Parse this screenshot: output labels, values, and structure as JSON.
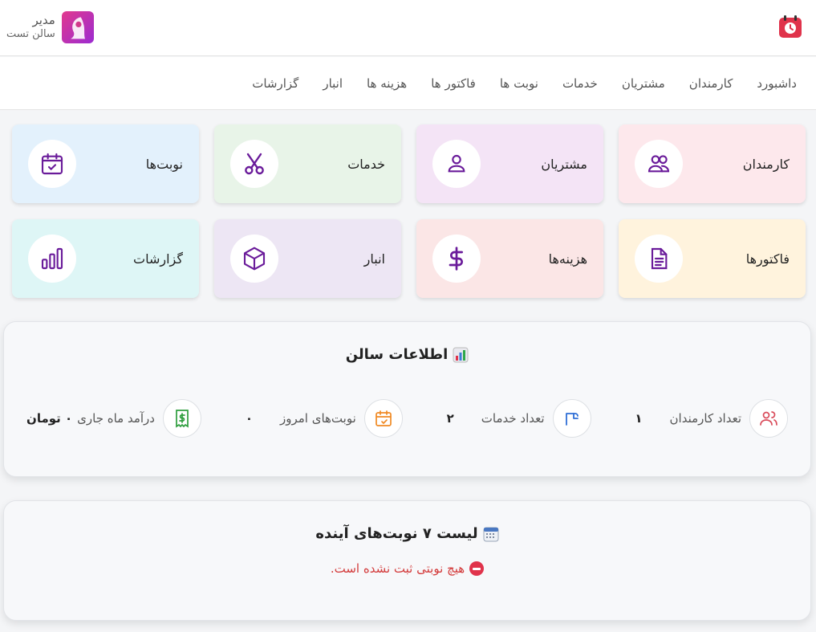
{
  "header": {
    "user_role": "مدیر",
    "salon_name": "سالن تست",
    "brand_icon": "calendar-logo-icon",
    "avatar_icon": "salon-avatar"
  },
  "nav": {
    "items": [
      {
        "label": "داشبورد"
      },
      {
        "label": "کارمندان"
      },
      {
        "label": "مشتریان"
      },
      {
        "label": "خدمات"
      },
      {
        "label": "نوبت ها"
      },
      {
        "label": "فاکتور ها"
      },
      {
        "label": "هزینه ها"
      },
      {
        "label": "انبار"
      },
      {
        "label": "گزارشات"
      }
    ]
  },
  "cards": [
    {
      "label": "کارمندان",
      "icon": "users-icon",
      "bg": "#fde8ec"
    },
    {
      "label": "مشتریان",
      "icon": "user-icon",
      "bg": "#f4e4f6"
    },
    {
      "label": "خدمات",
      "icon": "scissors-icon",
      "bg": "#e8f4e8"
    },
    {
      "label": "نوبت‌ها",
      "icon": "calendar-check-icon",
      "bg": "#e3f1fc"
    },
    {
      "label": "فاکتورها",
      "icon": "file-text-icon",
      "bg": "#fff3dd"
    },
    {
      "label": "هزینه‌ها",
      "icon": "dollar-icon",
      "bg": "#fbe6e6"
    },
    {
      "label": "انبار",
      "icon": "box-icon",
      "bg": "#ede6f4"
    },
    {
      "label": "گزارشات",
      "icon": "bar-chart-icon",
      "bg": "#def6f6"
    }
  ],
  "info": {
    "title": "اطلاعات سالن",
    "stats": [
      {
        "label": "تعداد کارمندان",
        "value": "۱",
        "icon": "users-icon",
        "color": "#d94b5a"
      },
      {
        "label": "تعداد خدمات",
        "value": "۲",
        "icon": "service-icon",
        "color": "#2f6fd6"
      },
      {
        "label": "نوبت‌های امروز",
        "value": "۰",
        "icon": "calendar-check-icon",
        "color": "#f08a24"
      }
    ],
    "income": {
      "label": "درآمد ماه جاری",
      "value": "۰ تومان",
      "icon": "receipt-dollar-icon",
      "color": "#2e9e3e"
    }
  },
  "appointments": {
    "title": "لیست ۷ نوبت‌های آینده",
    "empty_message": "هیچ نوبتی ثبت نشده است."
  },
  "colors": {
    "accent": "#6a1b9a",
    "danger": "#d33a3a"
  }
}
